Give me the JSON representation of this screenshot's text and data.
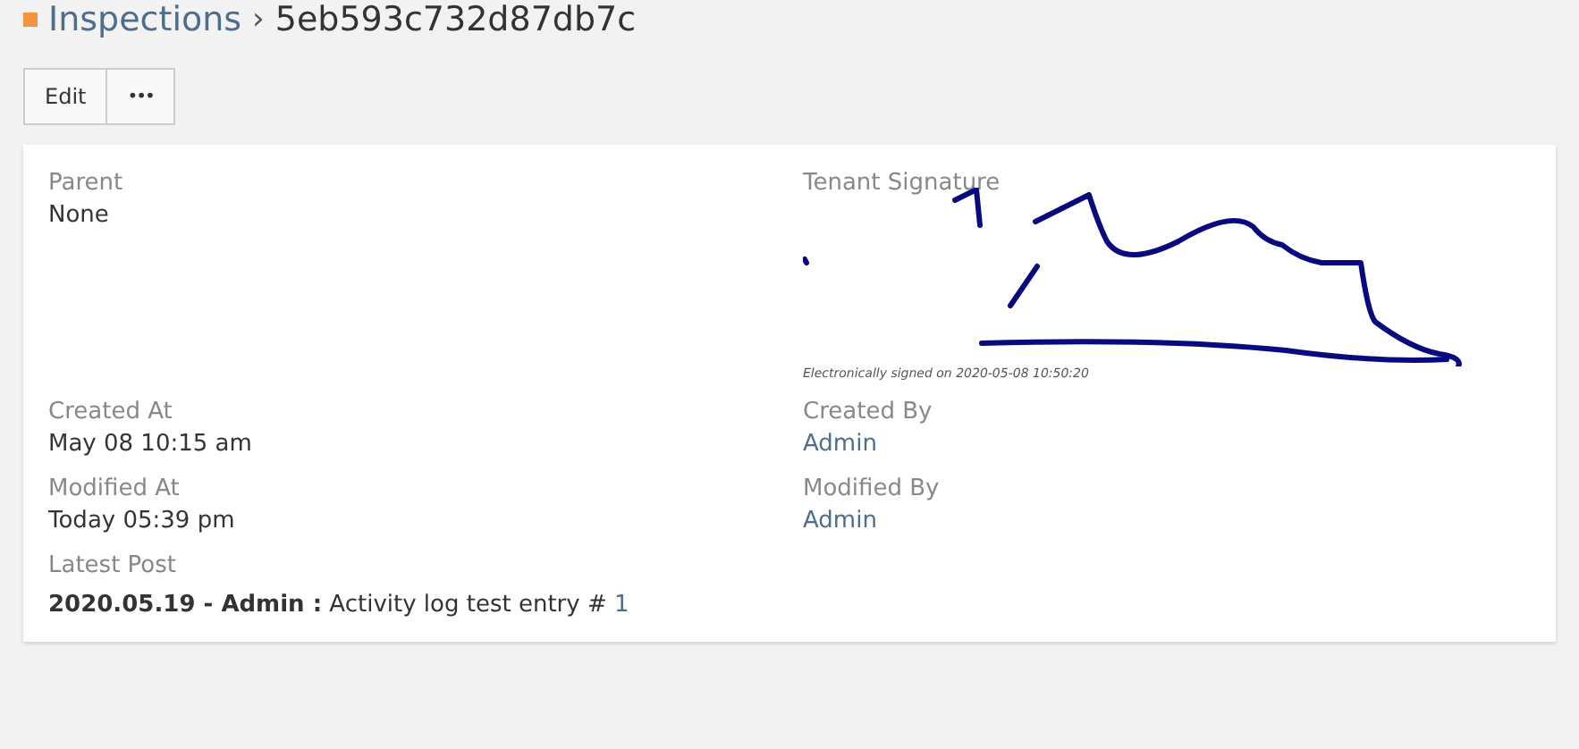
{
  "breadcrumb": {
    "parent": "Inspections",
    "separator": "›",
    "current": "5eb593c732d87db7c"
  },
  "toolbar": {
    "buttons": [
      {
        "kind": "text",
        "label": "Edit"
      },
      {
        "kind": "more",
        "label": "•••"
      }
    ]
  },
  "fields": [
    {
      "label": "Parent",
      "value": "None",
      "kind": "text"
    },
    {
      "label": "Tenant Signature",
      "kind": "signature",
      "caption": "Electronically signed on 2020-05-08 10:50:20"
    },
    {
      "label": "Created At",
      "value": "May 08 10:15 am",
      "kind": "text"
    },
    {
      "label": "Created By",
      "value": "Admin",
      "kind": "link"
    },
    {
      "label": "Modified At",
      "value": "Today 05:39 pm",
      "kind": "text"
    },
    {
      "label": "Modified By",
      "value": "Admin",
      "kind": "link"
    }
  ],
  "latest_post": {
    "label": "Latest Post",
    "text": "**2020.05.19 - Admin :** Activity log test entry # ",
    "link": "1"
  }
}
